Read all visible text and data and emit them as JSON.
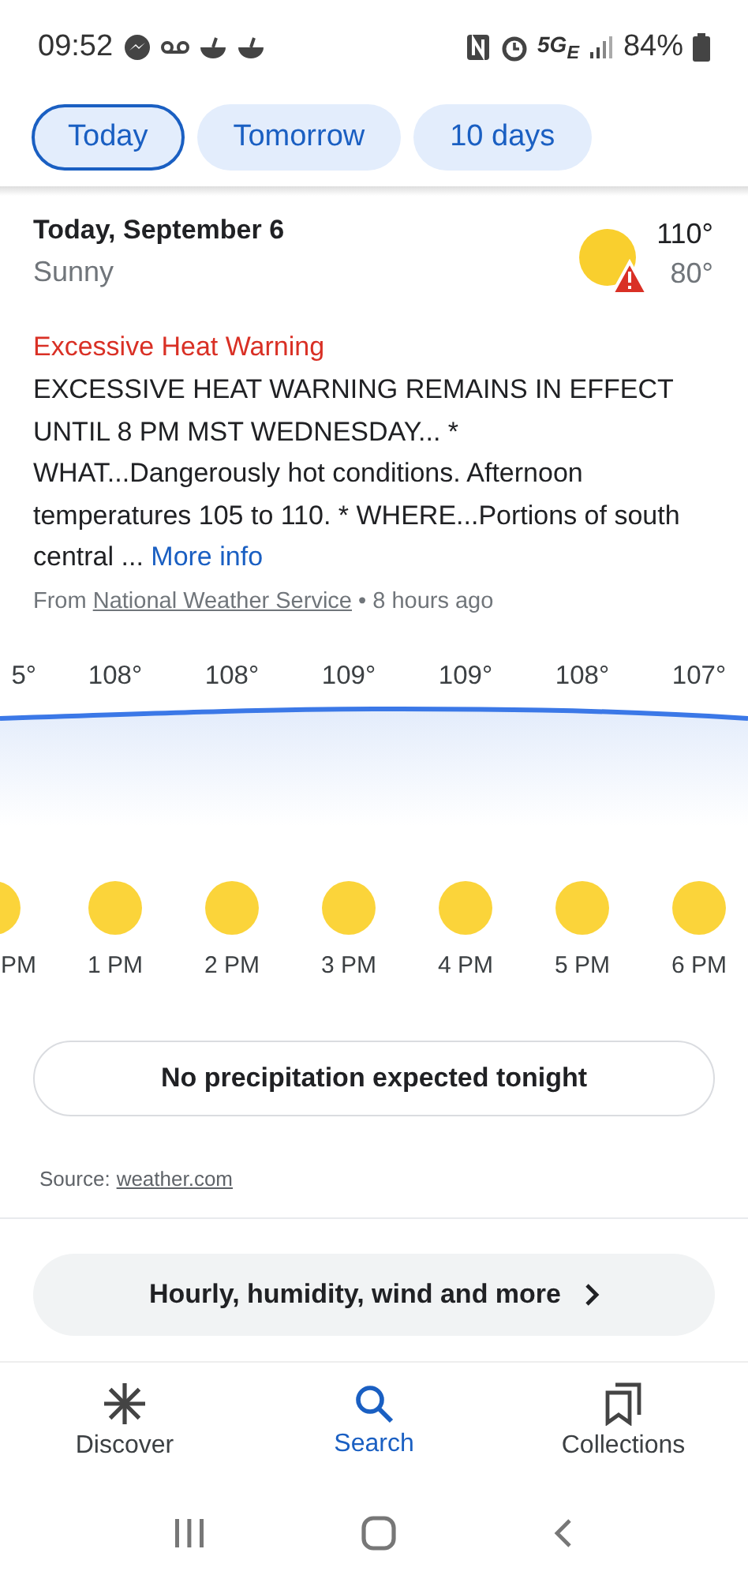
{
  "status_bar": {
    "time": "09:52",
    "battery": "84%",
    "network": "5G$_{E}$"
  },
  "tabs": [
    {
      "label": "Today",
      "selected": true
    },
    {
      "label": "Tomorrow",
      "selected": false
    },
    {
      "label": "10 days",
      "selected": false
    }
  ],
  "day": {
    "title": "Today, September 6",
    "condition": "Sunny",
    "high": "110°",
    "low": "80°",
    "alert": true
  },
  "alert": {
    "title": "Excessive Heat Warning",
    "text": "EXCESSIVE HEAT WARNING REMAINS IN EFFECT UNTIL 8 PM MST WEDNESDAY... * WHAT...Dangerously hot conditions. Afternoon temperatures 105 to 110. * WHERE...Portions of south central ...",
    "link": "More info",
    "source_prefix": "From",
    "source": "National Weather Service",
    "age": "• 8 hours ago"
  },
  "hourly": [
    {
      "temp": "5°",
      "time": "PM",
      "kind": "cut"
    },
    {
      "temp": "108°",
      "time": "1 PM",
      "kind": "full"
    },
    {
      "temp": "108°",
      "time": "2 PM",
      "kind": "full"
    },
    {
      "temp": "109°",
      "time": "3 PM",
      "kind": "full"
    },
    {
      "temp": "109°",
      "time": "4 PM",
      "kind": "full"
    },
    {
      "temp": "108°",
      "time": "5 PM",
      "kind": "full"
    },
    {
      "temp": "107°",
      "time": "6 PM",
      "kind": "full"
    }
  ],
  "precipitation": "No precipitation expected tonight",
  "source": {
    "label": "Source:",
    "link": "weather.com"
  },
  "more_button": "Hourly, humidity, wind and more",
  "bottom_nav": [
    {
      "label": "Discover",
      "selected": false
    },
    {
      "label": "Search",
      "selected": true
    },
    {
      "label": "Collections",
      "selected": false
    }
  ]
}
